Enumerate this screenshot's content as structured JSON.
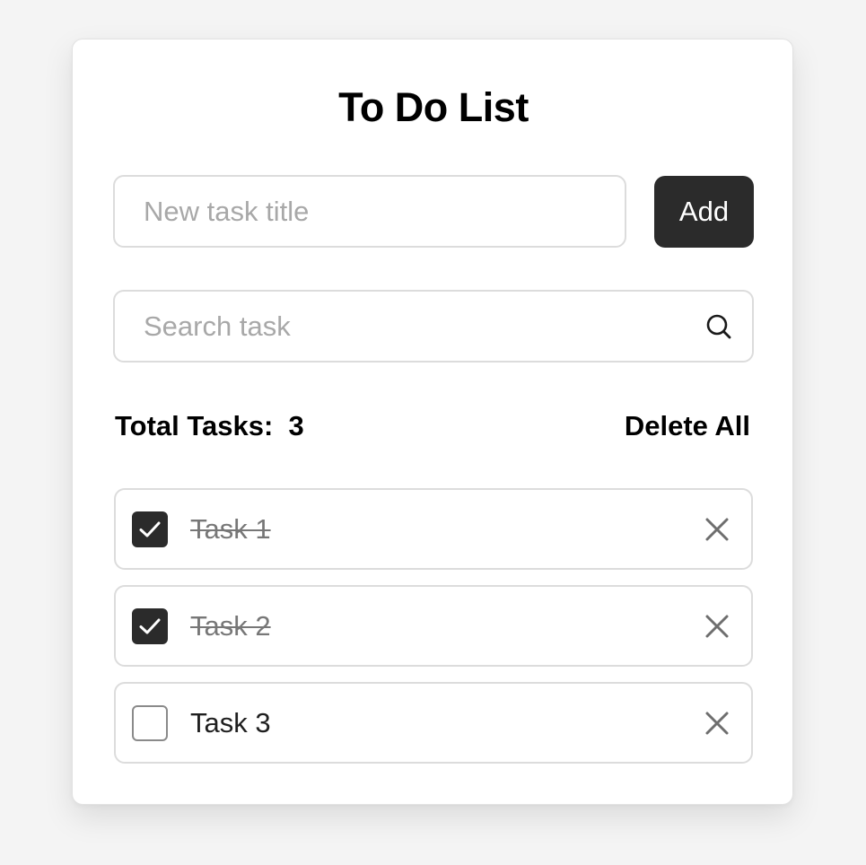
{
  "app": {
    "title": "To Do List"
  },
  "new_task": {
    "placeholder": "New task title",
    "value": "",
    "add_label": "Add"
  },
  "search": {
    "placeholder": "Search task",
    "value": "",
    "icon": "search-icon"
  },
  "summary": {
    "total_label": "Total Tasks:",
    "total_count": "3",
    "delete_all_label": "Delete All"
  },
  "tasks": [
    {
      "title": "Task 1",
      "completed": true
    },
    {
      "title": "Task 2",
      "completed": true
    },
    {
      "title": "Task 3",
      "completed": false
    }
  ],
  "colors": {
    "accent": "#2b2b2b",
    "background": "#f4f4f4",
    "card": "#ffffff",
    "border": "#dcdcdc",
    "completed_text": "#777777"
  }
}
